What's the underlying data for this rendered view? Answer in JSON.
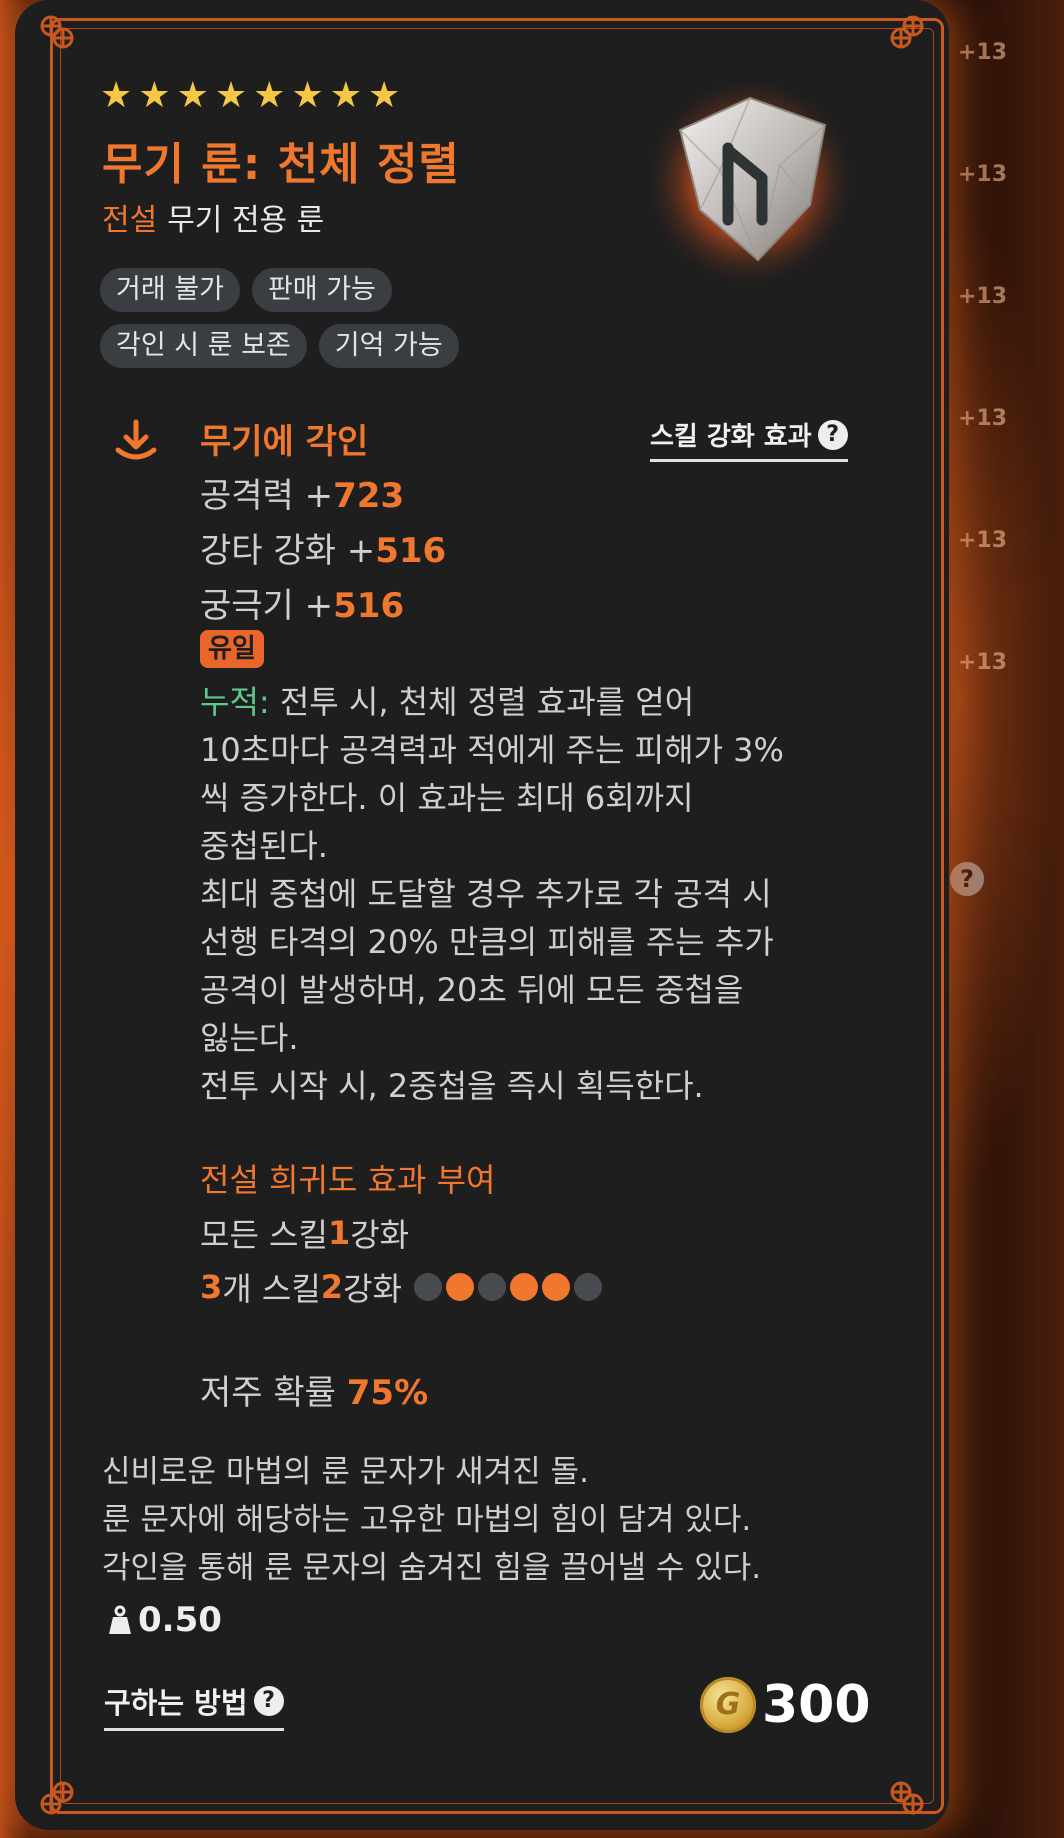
{
  "item": {
    "star_count": 8,
    "title": "무기 룬: 천체 정렬",
    "grade": "전설",
    "category": "무기 전용 룬",
    "tags": [
      "거래 불가",
      "판매 가능",
      "각인 시 룬 보존",
      "기억 가능"
    ],
    "icon": "rune-stone-icon"
  },
  "engrave": {
    "title": "무기에 각인",
    "skill_link": "스킬 강화 효과",
    "stats": [
      {
        "label": "공격력 +",
        "value": "723"
      },
      {
        "label": "강타 강화 +",
        "value": "516"
      },
      {
        "label": "궁극기 +",
        "value": "516"
      }
    ],
    "unique_badge": "유일",
    "stack_label": "누적:",
    "desc_lines": [
      " 전투 시, 천체 정렬 효과를 얻어",
      "10초마다 공격력과 적에게 주는 피해가 3%",
      "씩 증가한다. 이 효과는 최대 6회까지",
      "중첩된다.",
      "최대 중첩에 도달할 경우 추가로 각 공격 시",
      "선행 타격의 20% 만큼의 피해를 주는 추가",
      "공격이 발생하며, 20초 뒤에 모든 중첩을",
      "잃는다.",
      "전투 시작 시, 2중첩을 즉시 획득한다."
    ]
  },
  "legend": {
    "title": "전설 희귀도 효과 부여",
    "line1_prefix": "모든 스킬 ",
    "line1_value": "1",
    "line1_suffix": "강화",
    "line2_value1": "3",
    "line2_mid": "개 스킬 ",
    "line2_value2": "2",
    "line2_suffix": "강화",
    "dots": [
      false,
      true,
      false,
      true,
      true,
      false
    ]
  },
  "curse": {
    "label": "저주 확률 ",
    "value": "75%"
  },
  "flavor": [
    "신비로운 마법의 룬 문자가 새겨진 돌.",
    "룬 문자에 해당하는 고유한 마법의 힘이 담겨 있다.",
    "각인을 통해 룬 문자의 숨겨진 힘을 끌어낼 수 있다."
  ],
  "weight": "0.50",
  "howto": "구하는 방법",
  "price": "300",
  "side_tags": [
    "+13",
    "+13",
    "+13",
    "+13",
    "+13",
    "+13"
  ],
  "colors": {
    "accent": "#f0772e",
    "star": "#f6c645",
    "stack": "#5ec98a",
    "card": "#1e1e1e"
  }
}
